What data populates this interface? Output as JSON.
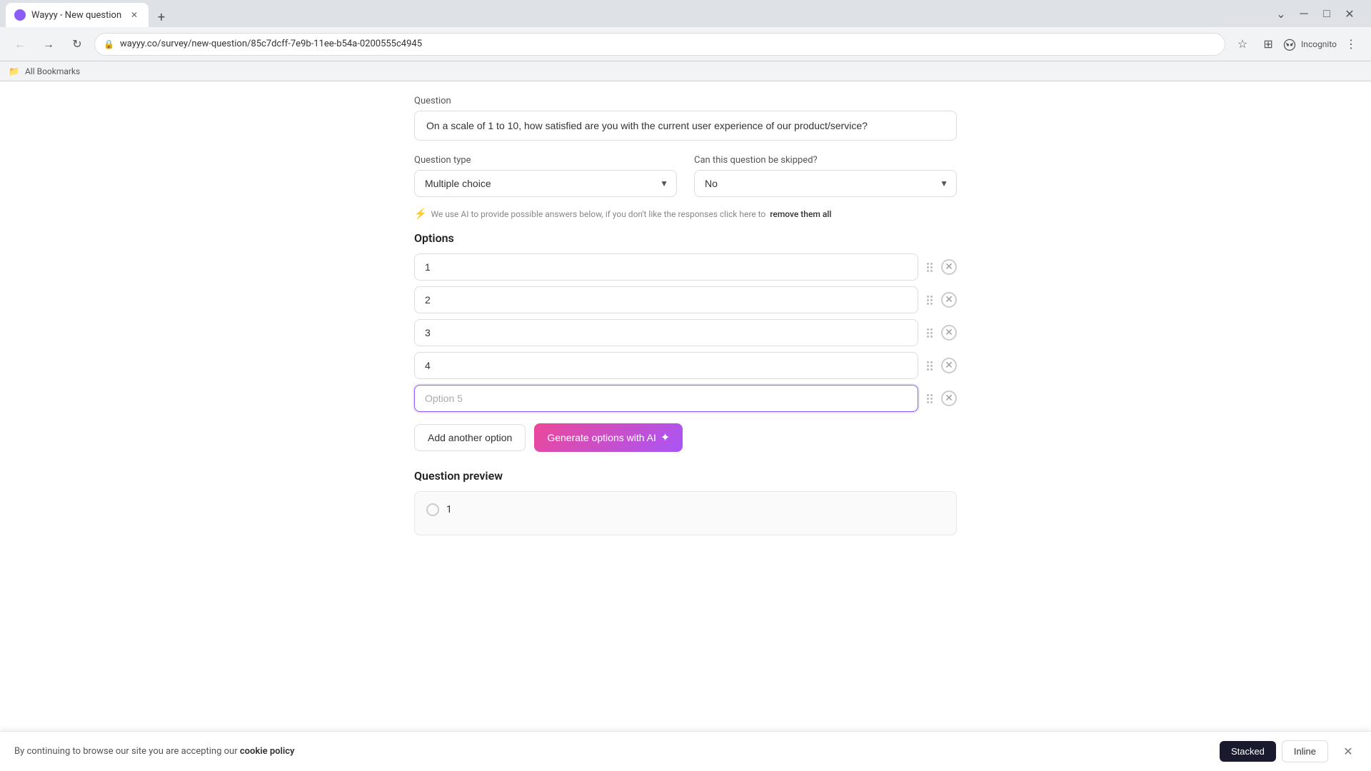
{
  "browser": {
    "tab_title": "Wayyy - New question",
    "url": "wayyy.co/survey/new-question/85c7dcff-7e9b-11ee-b54a-0200555c4945",
    "favicon_color": "#8b5cf6",
    "incognito_label": "Incognito",
    "bookmarks_label": "All Bookmarks"
  },
  "form": {
    "question_label": "Question",
    "question_value": "On a scale of 1 to 10, how satisfied are you with the current user experience of our product/service?",
    "question_type_label": "Question type",
    "question_type_value": "Multiple choice",
    "skip_label": "Can this question be skipped?",
    "skip_value": "No",
    "ai_notice": "We use AI to provide possible answers below, if you don't like the responses click here to",
    "ai_notice_link": "remove them all",
    "options_label": "Options",
    "options": [
      {
        "id": 1,
        "value": "1",
        "placeholder": ""
      },
      {
        "id": 2,
        "value": "2",
        "placeholder": ""
      },
      {
        "id": 3,
        "value": "3",
        "placeholder": ""
      },
      {
        "id": 4,
        "value": "4",
        "placeholder": ""
      },
      {
        "id": 5,
        "value": "",
        "placeholder": "Option 5"
      }
    ],
    "add_option_label": "Add another option",
    "generate_ai_label": "Generate options with AI",
    "preview_label": "Question preview",
    "preview_options": [
      {
        "id": 1,
        "value": "1"
      }
    ]
  },
  "cookie_banner": {
    "text": "By continuing to browse our site you are accepting our",
    "link_text": "cookie policy",
    "stacked_label": "Stacked",
    "inline_label": "Inline"
  }
}
